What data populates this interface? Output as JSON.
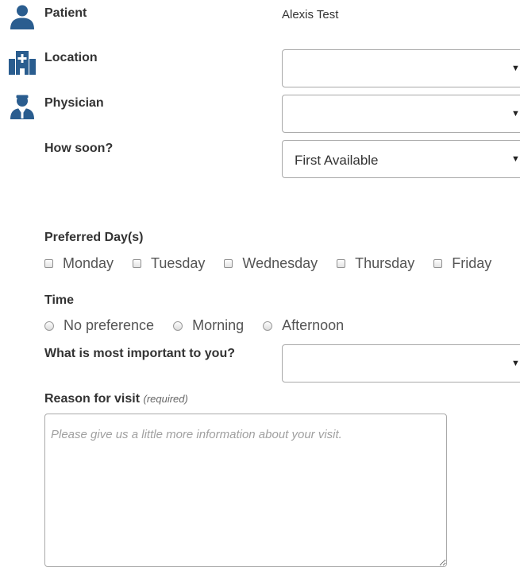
{
  "patient": {
    "label": "Patient",
    "value": "Alexis Test"
  },
  "location": {
    "label": "Location",
    "value": ""
  },
  "physician": {
    "label": "Physician",
    "value": ""
  },
  "how_soon": {
    "label": "How soon?",
    "value": "First Available"
  },
  "preferred_days": {
    "label": "Preferred Day(s)",
    "options": [
      "Monday",
      "Tuesday",
      "Wednesday",
      "Thursday",
      "Friday"
    ]
  },
  "time": {
    "label": "Time",
    "options": [
      "No preference",
      "Morning",
      "Afternoon"
    ]
  },
  "important": {
    "label": "What is most important to you?",
    "value": ""
  },
  "reason": {
    "label": "Reason for visit",
    "required": "(required)",
    "placeholder": "Please give us a little more information about your visit."
  },
  "icons": {
    "patient": "person-icon",
    "location": "hospital-icon",
    "physician": "doctor-icon"
  },
  "colors": {
    "icon": "#2a5d8f",
    "border": "#a9a9a9"
  }
}
